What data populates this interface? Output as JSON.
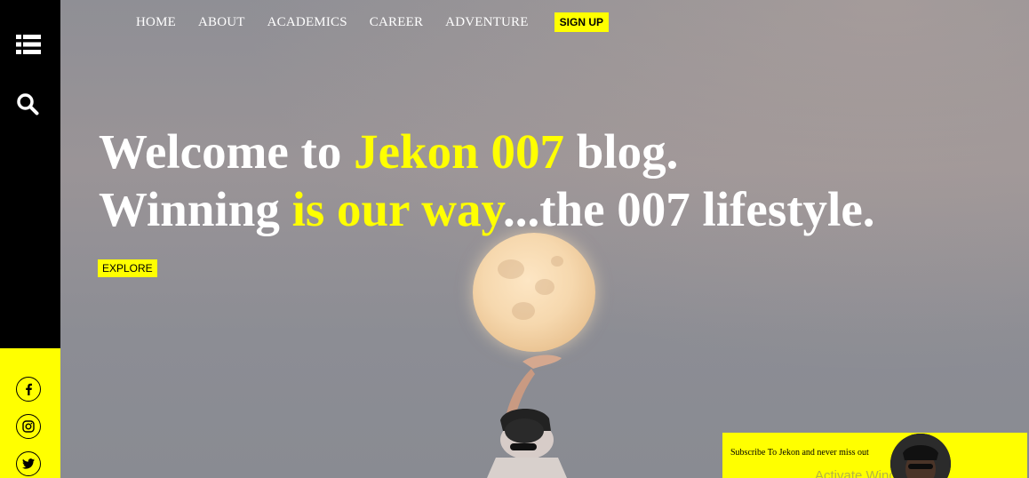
{
  "sidebar": {
    "menu_icon": "list-icon",
    "search_icon": "search-icon",
    "social": [
      {
        "name": "facebook",
        "icon": "facebook-icon"
      },
      {
        "name": "instagram",
        "icon": "instagram-icon"
      },
      {
        "name": "twitter",
        "icon": "twitter-icon"
      }
    ]
  },
  "nav": {
    "items": [
      "HOME",
      "ABOUT",
      "ACADEMICS",
      "CAREER",
      "ADVENTURE"
    ],
    "signup_label": "SIGN UP"
  },
  "hero": {
    "line1_a": "Welcome to ",
    "line1_b": "Jekon 007",
    "line1_c": " blog.",
    "line2_a": "Winning ",
    "line2_b": "is our way",
    "line2_c": "...the 007 lifestyle.",
    "explore_label": "EXPLORE"
  },
  "subscribe": {
    "text": "Subscribe To Jekon and never miss out",
    "watermark": "Activate Windows"
  },
  "colors": {
    "accent": "#ffff00",
    "sidebar": "#000000",
    "text": "#ffffff"
  }
}
